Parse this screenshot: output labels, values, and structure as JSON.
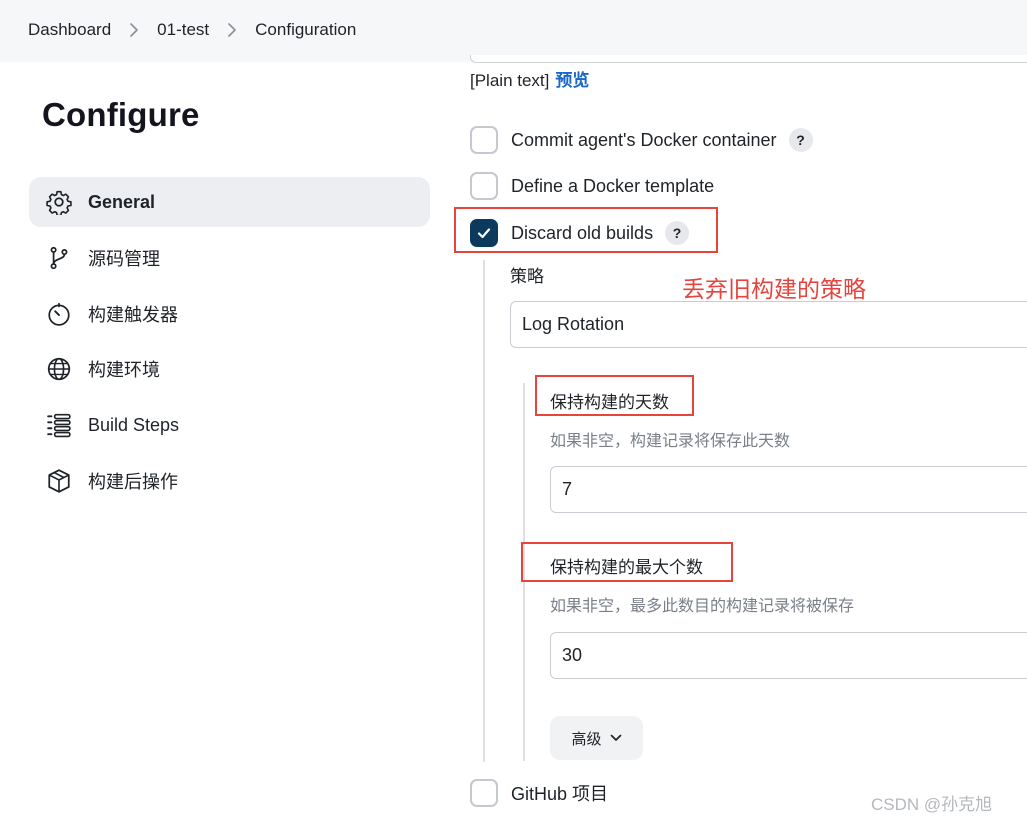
{
  "breadcrumb": {
    "items": [
      "Dashboard",
      "01-test",
      "Configuration"
    ]
  },
  "sidebar": {
    "title": "Configure",
    "items": [
      {
        "label": "General",
        "icon": "gear-icon",
        "active": true
      },
      {
        "label": "源码管理",
        "icon": "branch-icon",
        "active": false
      },
      {
        "label": "构建触发器",
        "icon": "timer-icon",
        "active": false
      },
      {
        "label": "构建环境",
        "icon": "globe-icon",
        "active": false
      },
      {
        "label": "Build Steps",
        "icon": "list-icon",
        "active": false
      },
      {
        "label": "构建后操作",
        "icon": "package-icon",
        "active": false
      }
    ]
  },
  "main": {
    "plain_text": "[Plain text]",
    "preview_link": "预览",
    "options": {
      "commit_docker": {
        "label": "Commit agent's Docker container",
        "checked": false,
        "help": "?"
      },
      "define_docker": {
        "label": "Define a Docker template",
        "checked": false
      },
      "discard_old": {
        "label": "Discard old builds",
        "checked": true,
        "help": "?"
      },
      "github": {
        "label": "GitHub 项目",
        "checked": false
      }
    },
    "strategy": {
      "label": "策略",
      "annotation": "丢弃旧构建的策略",
      "selected": "Log Rotation"
    },
    "days_to_keep": {
      "label": "保持构建的天数",
      "hint": "如果非空，构建记录将保存此天数",
      "value": "7"
    },
    "max_builds": {
      "label": "保持构建的最大个数",
      "hint": "如果非空，最多此数目的构建记录将被保存",
      "value": "30"
    },
    "advanced_button": "高级"
  },
  "watermark": "CSDN @孙克旭",
  "colors": {
    "checkbox_checked": "#0c3a5e",
    "annotation_red": "#e5453d",
    "link_blue": "#1a66c9",
    "active_nav_bg": "#eceef2"
  }
}
